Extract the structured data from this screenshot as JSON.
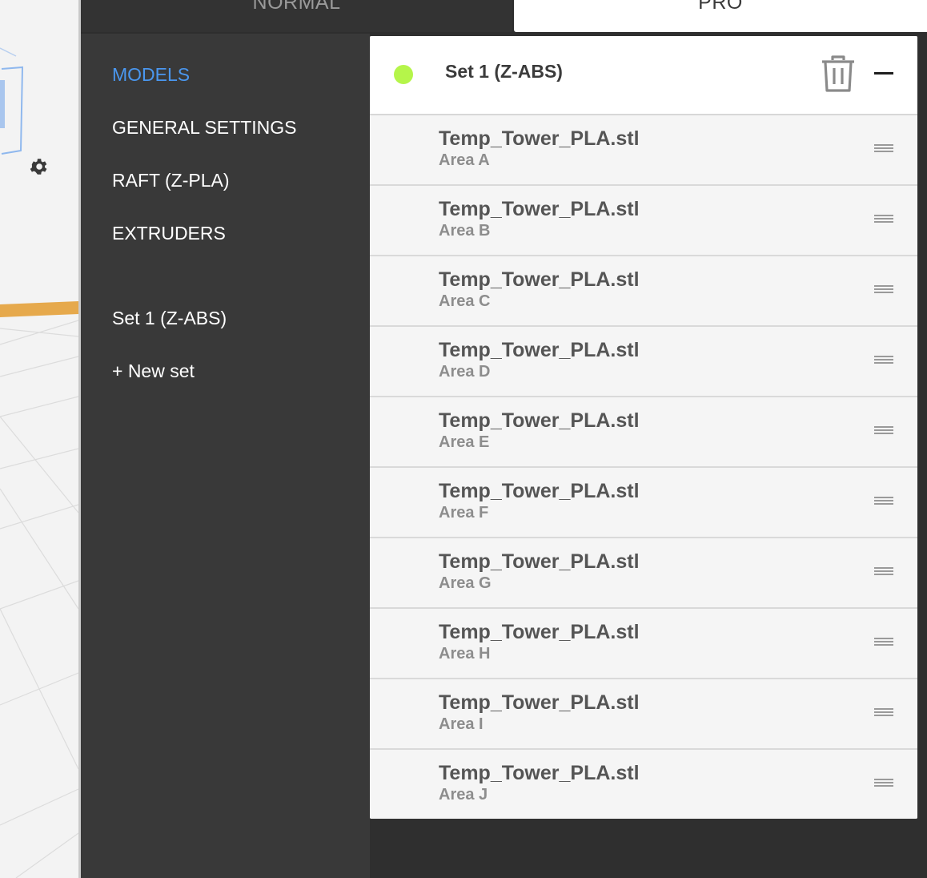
{
  "tabs": {
    "normal": "NORMAL",
    "pro": "PRO",
    "active": "PRO"
  },
  "sidebar": {
    "items": [
      {
        "label": "MODELS",
        "active": true
      },
      {
        "label": "GENERAL SETTINGS"
      },
      {
        "label": "RAFT (Z-PLA)"
      },
      {
        "label": "EXTRUDERS"
      }
    ],
    "sets": [
      {
        "label": "Set 1 (Z-ABS)"
      }
    ],
    "new_set": "+ New set"
  },
  "panel": {
    "title": "Set 1 (Z-ABS)",
    "status_color": "#b5f54a",
    "icons": [
      "trash-icon",
      "collapse-icon",
      "drag-handle-icon",
      "gear-icon"
    ],
    "models": [
      {
        "name": "Temp_Tower_PLA.stl",
        "area": "Area A"
      },
      {
        "name": "Temp_Tower_PLA.stl",
        "area": "Area B"
      },
      {
        "name": "Temp_Tower_PLA.stl",
        "area": "Area C"
      },
      {
        "name": "Temp_Tower_PLA.stl",
        "area": "Area D"
      },
      {
        "name": "Temp_Tower_PLA.stl",
        "area": "Area E"
      },
      {
        "name": "Temp_Tower_PLA.stl",
        "area": "Area F"
      },
      {
        "name": "Temp_Tower_PLA.stl",
        "area": "Area G"
      },
      {
        "name": "Temp_Tower_PLA.stl",
        "area": "Area H"
      },
      {
        "name": "Temp_Tower_PLA.stl",
        "area": "Area I"
      },
      {
        "name": "Temp_Tower_PLA.stl",
        "area": "Area J"
      }
    ]
  },
  "colors": {
    "accent": "#4a97ef",
    "sidebar_bg": "#393939",
    "model_outline": "#e0a84a"
  }
}
